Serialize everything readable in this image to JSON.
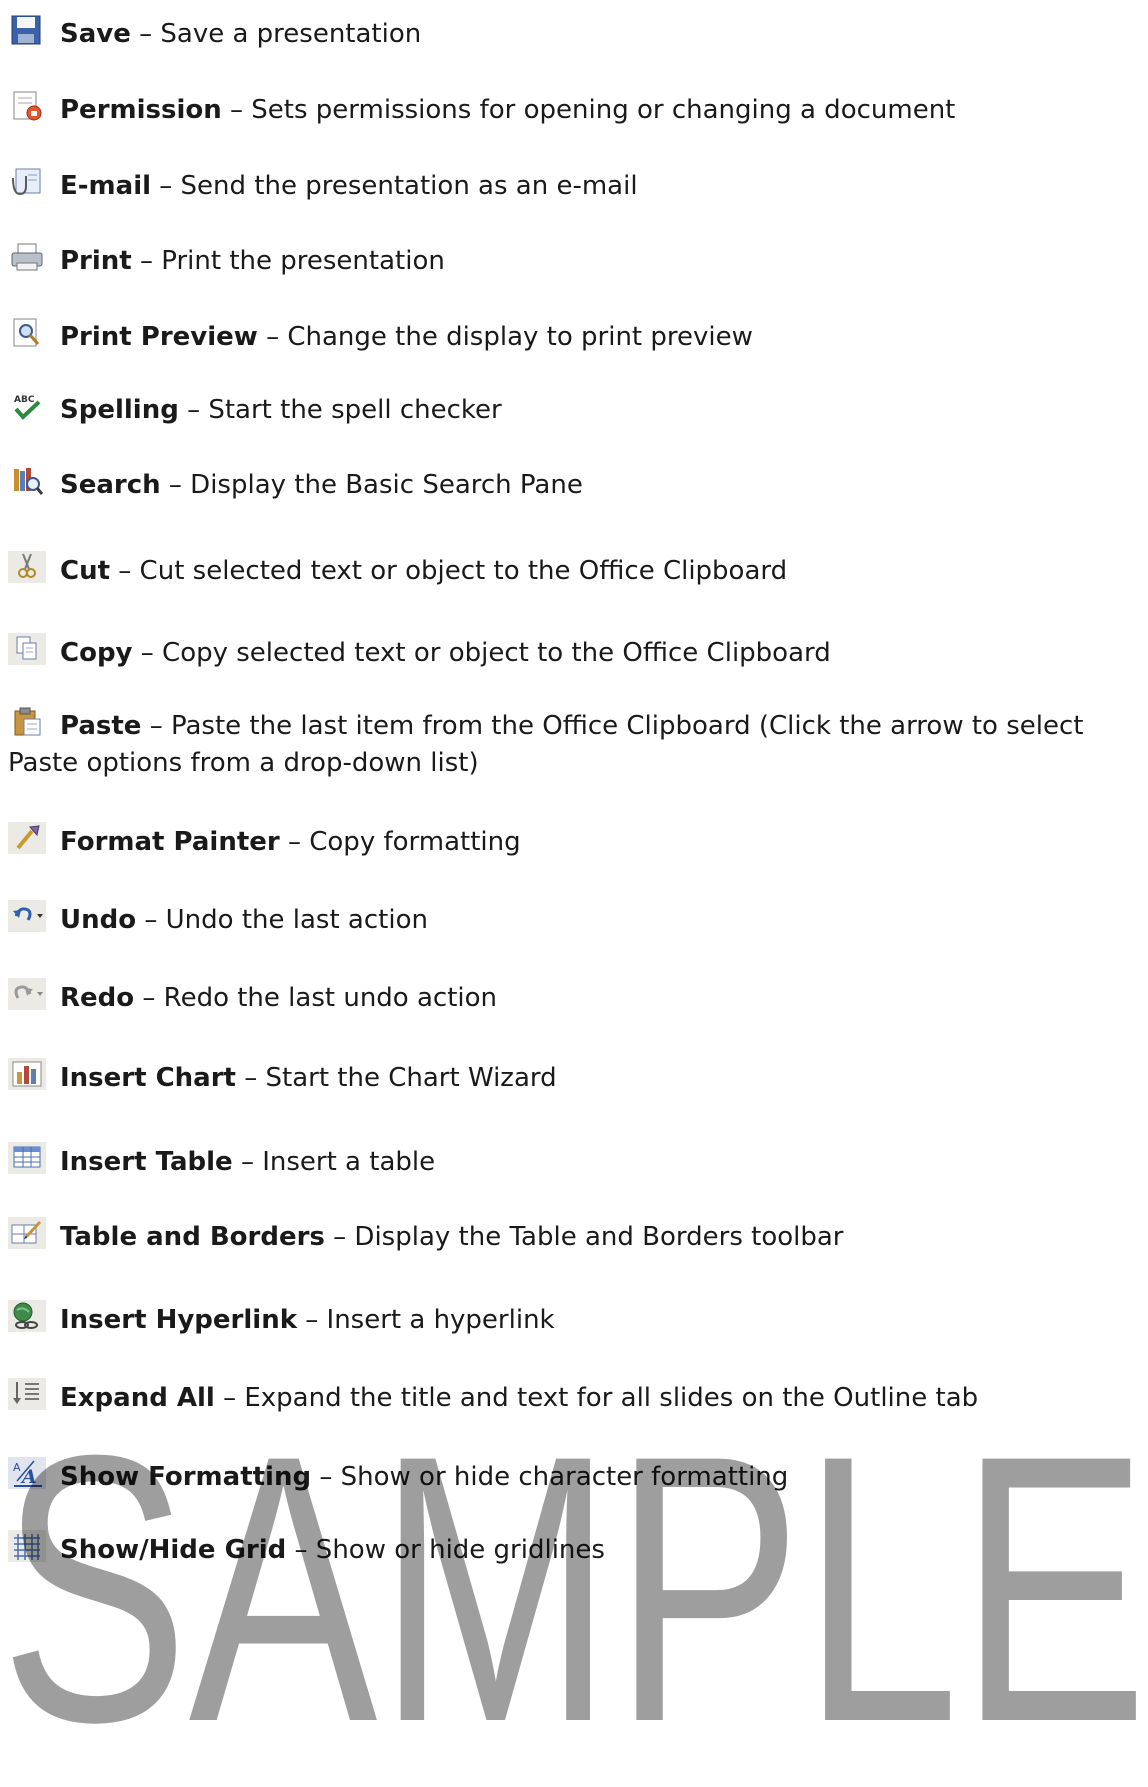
{
  "entries": [
    {
      "term": "Save",
      "desc": " – Save a presentation",
      "icon": "save-icon"
    },
    {
      "term": "Permission",
      "desc": " – Sets permissions for opening or changing a document",
      "icon": "permission-icon"
    },
    {
      "term": "E-mail",
      "desc": " – Send the presentation as an e-mail",
      "icon": "email-icon"
    },
    {
      "term": "Print",
      "desc": " – Print the presentation",
      "icon": "print-icon"
    },
    {
      "term": "Print Preview",
      "desc": " – Change the display to print preview",
      "icon": "print-preview-icon"
    },
    {
      "term": "Spelling",
      "desc": " – Start the spell checker",
      "icon": "spelling-icon"
    },
    {
      "term": "Search",
      "desc": " – Display the Basic Search Pane",
      "icon": "search-icon"
    },
    {
      "term": "Cut",
      "desc": " – Cut selected text or object to the Office Clipboard",
      "icon": "cut-icon"
    },
    {
      "term": "Copy",
      "desc": " – Copy selected text or object to the Office Clipboard",
      "icon": "copy-icon"
    },
    {
      "term": "Paste",
      "desc": " – Paste the last item from the Office Clipboard (Click the arrow to select Paste options from a drop-down list)",
      "icon": "paste-icon"
    },
    {
      "term": "Format Painter",
      "desc": " – Copy formatting",
      "icon": "format-painter-icon"
    },
    {
      "term": "Undo",
      "desc": " – Undo the last action",
      "icon": "undo-icon"
    },
    {
      "term": "Redo",
      "desc": " – Redo the last undo action",
      "icon": "redo-icon"
    },
    {
      "term": "Insert Chart",
      "desc": " – Start the Chart Wizard",
      "icon": "insert-chart-icon"
    },
    {
      "term": "Insert Table",
      "desc": " – Insert a table",
      "icon": "insert-table-icon"
    },
    {
      "term": "Table and Borders",
      "desc": " – Display the Table and Borders toolbar",
      "icon": "table-borders-icon"
    },
    {
      "term": "Insert Hyperlink",
      "desc": " – Insert a hyperlink",
      "icon": "hyperlink-icon"
    },
    {
      "term": "Expand All",
      "desc": " – Expand the title and text for all slides on the Outline tab",
      "icon": "expand-all-icon"
    },
    {
      "term": "Show Formatting",
      "desc": " – Show or hide character formatting",
      "icon": "show-formatting-icon"
    },
    {
      "term": "Show/Hide Grid",
      "desc": " – Show or hide gridlines",
      "icon": "grid-icon"
    }
  ],
  "watermark": "SAMPLE"
}
